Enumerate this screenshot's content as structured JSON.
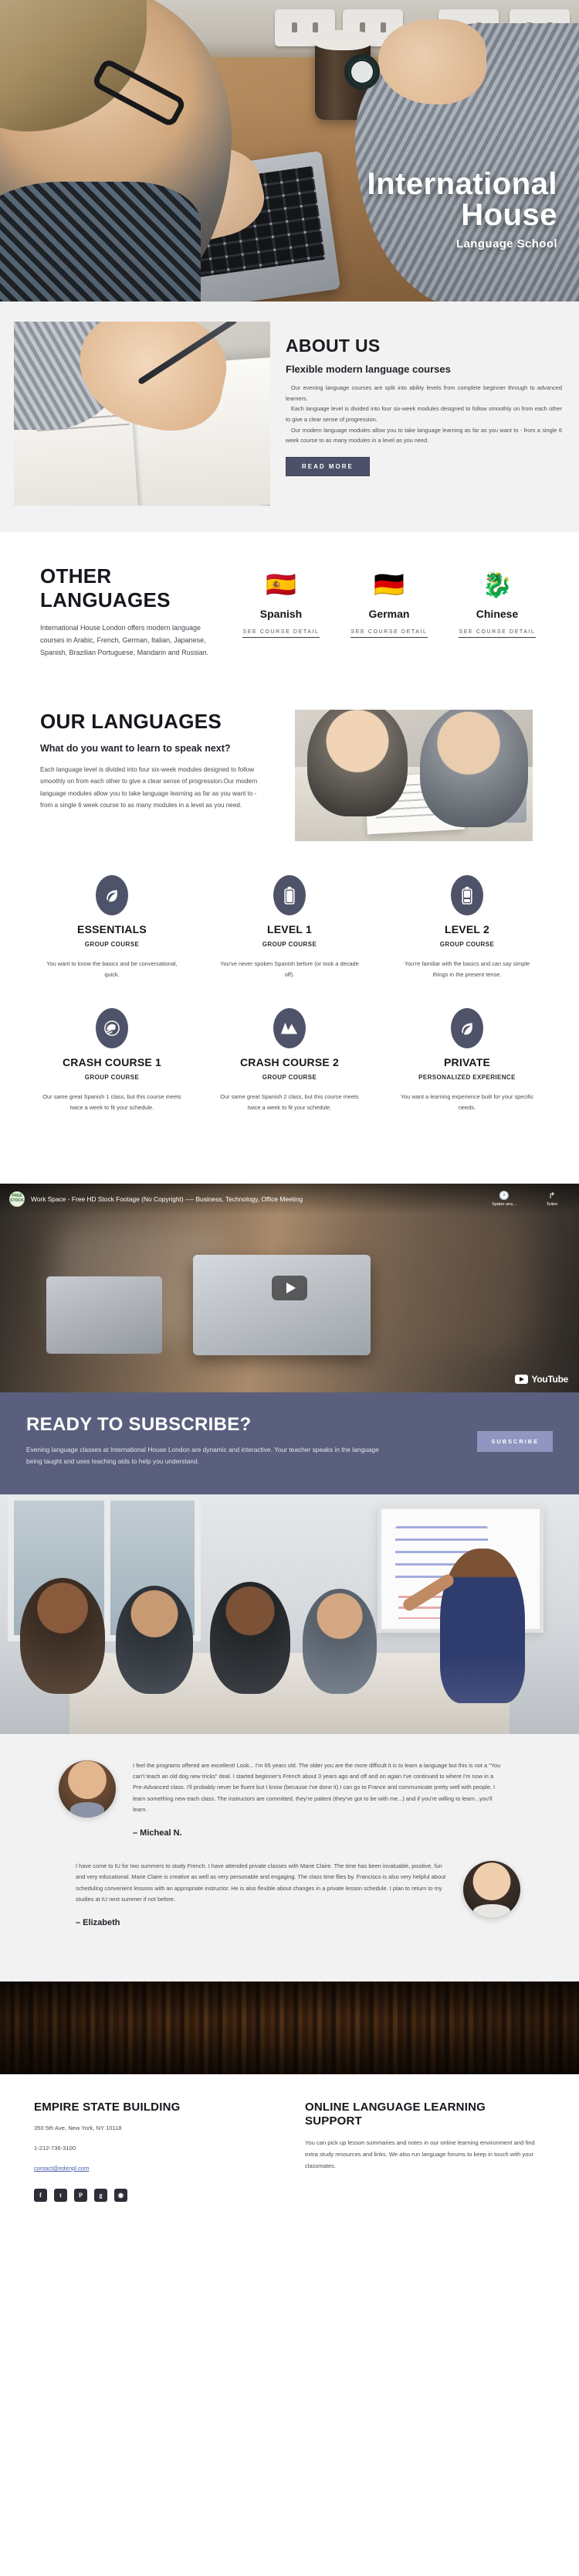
{
  "hero": {
    "title_line1": "International",
    "title_line2": "House",
    "subtitle": "Language School"
  },
  "about": {
    "heading": "ABOUT US",
    "subheading": "Flexible modern language courses",
    "para1": "Our evening language courses are split into ability levels from complete beginner through to advanced learners.",
    "para2": "Each language level is divided into four six-week modules designed to follow smoothly on from each other to give a clear sense of progression.",
    "para3": "Our modern language modules allow you to take language learning as far as you want to - from a single 6 week course to as many modules in a level as you need.",
    "button": "READ MORE"
  },
  "other_languages": {
    "heading": "OTHER LANGUAGES",
    "description": "International House London offers modern language courses in Arabic, French, German, Italian, Japanese, Spanish, Brazilian Portuguese, Mandarin and Russian.",
    "cards": [
      {
        "icon": "spain-flag-icon",
        "emoji": "🇪🇸",
        "name": "Spanish",
        "link": "SEE COURSE DETAIL"
      },
      {
        "icon": "germany-flag-icon",
        "emoji": "🇩🇪",
        "name": "German",
        "link": "SEE COURSE DETAIL"
      },
      {
        "icon": "dragon-icon",
        "emoji": "🐉",
        "name": "Chinese",
        "link": "SEE COURSE DETAIL"
      }
    ]
  },
  "our_languages": {
    "heading": "OUR LANGUAGES",
    "subheading": "What do you want to learn to speak next?",
    "description": "Each language level is divided into four six-week modules designed to follow smoothly on from each other to give a clear sense of progression.Our modern language modules allow you to take language learning as far as you want to - from a single 6 week course to as many modules in a level as you need."
  },
  "courses": [
    {
      "icon": "leaf-icon",
      "title": "ESSENTIALS",
      "kind": "GROUP COURSE",
      "description": "You want to know the basics and be conversational, quick."
    },
    {
      "icon": "battery-full-icon",
      "title": "LEVEL 1",
      "kind": "GROUP COURSE",
      "description": "You've never spoken Spanish before (or took a decade off)."
    },
    {
      "icon": "battery-half-icon",
      "title": "LEVEL 2",
      "kind": "GROUP COURSE",
      "description": "You're familiar with the basics and can say simple things in the present tense."
    },
    {
      "icon": "helmet-icon",
      "title": "CRASH COURSE 1",
      "kind": "GROUP COURSE",
      "description": "Our same great Spanish 1 class, but this course meets twice a week to fit your schedule."
    },
    {
      "icon": "mountains-icon",
      "title": "CRASH COURSE 2",
      "kind": "GROUP COURSE",
      "description": "Our same great Spanish 2 class, but this course meets twice a week to fit your schedule."
    },
    {
      "icon": "leaf-icon",
      "title": "PRIVATE",
      "kind": "PERSONALIZED EXPERIENCE",
      "description": "You want a learning experience built for your specific needs."
    }
  ],
  "video": {
    "channel_badge_line1": "FREE",
    "channel_badge_line2": "STOCK",
    "title": "Work Space - Free HD Stock Footage (No Copyright) ---- Business, Technology, Office Meeting",
    "action_watch_later": "Später ans...",
    "action_share": "Teilen",
    "watermark": "YouTube"
  },
  "subscribe": {
    "heading": "READY TO SUBSCRIBE?",
    "description": "Evening language classes at International House London are dynamic and interactive. Your teacher speaks in the language being taught and uses teaching aids to help you understand.",
    "button": "SUBSCRIBE"
  },
  "testimonials": [
    {
      "avatar": "male-avatar",
      "text": "I feel the programs offered are excellent!  Look... I'm 65 years old.  The older you are the more difficult it is to learn a language but this is not a \"You can't teach an old dog new tricks\" deal.  I started beginner's French about 3 years ago and off and on again I've continued to where I'm now in a Pre-Advanced class.  I'll probably never be fluent but I know (because I've done it) I can go to France and communicate pretty well with people.  I learn something new each class.  The instructors are committed, they're patient (they've got to be with me...) and if you're willing to learn...you'll learn.",
      "name": "– Micheal N."
    },
    {
      "avatar": "female-avatar",
      "text": "I have come to IU for two summers to study French. I have attended private classes with Marie Claire. The time has been invaluable, positive, fun and very educational. Marie Claire is creative as well as very personable and engaging. The class time flies by. Francisco is also very helpful about scheduling convenient lessons with an appropriate instructor. He is also flexible about changes in a private lesson schedule. I plan to return to my studies at IU next summer if not before.",
      "name": "– Elizabeth"
    }
  ],
  "footer": {
    "left": {
      "heading": "EMPIRE STATE BUILDING",
      "address": "350 5th Ave, New York, NY 10118",
      "phone": "1-212-736-3100",
      "email": "contact@edenpl.com"
    },
    "right": {
      "heading": "ONLINE LANGUAGE LEARNING SUPPORT",
      "text": "You can pick up lesson summaries and notes in our online learning environment and find extra study resources and links. We also run language forums to keep in touch with your classmates."
    },
    "socials": [
      {
        "name": "facebook-icon",
        "glyph": "f"
      },
      {
        "name": "twitter-icon",
        "glyph": "t"
      },
      {
        "name": "pinterest-icon",
        "glyph": "P"
      },
      {
        "name": "google-plus-icon",
        "glyph": "g"
      },
      {
        "name": "instagram-icon",
        "glyph": "◉"
      }
    ]
  }
}
